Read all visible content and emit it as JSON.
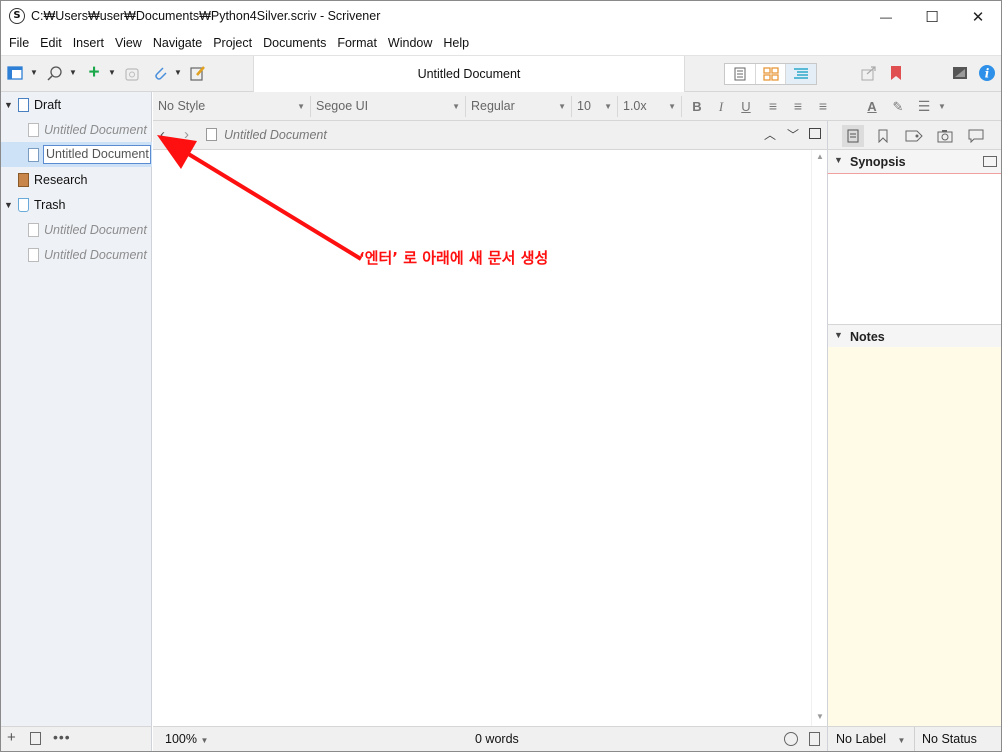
{
  "window": {
    "title": "C:₩Users₩user₩Documents₩Python4Silver.scriv - Scrivener",
    "logo": "S",
    "controls": {
      "minimize": "—",
      "maximize": "☐",
      "close": "✕"
    }
  },
  "menu": [
    "File",
    "Edit",
    "Insert",
    "View",
    "Navigate",
    "Project",
    "Documents",
    "Format",
    "Window",
    "Help"
  ],
  "toolbar": {
    "document_title": "Untitled Document",
    "icons": [
      "binder-toggle-icon",
      "search-icon",
      "add-icon",
      "trash-icon",
      "attach-icon",
      "compose-icon",
      "view-document-icon",
      "view-corkboard-icon",
      "view-outline-icon",
      "share-icon",
      "bookmark-icon",
      "composition-mode-icon",
      "info-icon"
    ],
    "accent_green": "#1aa84a",
    "accent_blue": "#2e7fd6",
    "bookmark_red": "#e05050",
    "corkboard_orange": "#e8983a"
  },
  "binder": {
    "items": [
      {
        "label": "Draft",
        "italic": false,
        "expanded": true
      },
      {
        "label": "Untitled Document",
        "italic": true
      },
      {
        "label": "Untitled Document",
        "editing": true
      },
      {
        "label": "Research",
        "italic": false
      },
      {
        "label": "Trash",
        "italic": false,
        "expanded": true
      },
      {
        "label": "Untitled Document",
        "italic": true
      },
      {
        "label": "Untitled Document",
        "italic": true
      }
    ],
    "selected_bg": "#cde2f7"
  },
  "formatbar": {
    "style": "No Style",
    "font": "Segoe UI",
    "weight": "Regular",
    "size": "10",
    "line_spacing": "1.0x"
  },
  "header": {
    "document_title": "Untitled Document"
  },
  "inspector": {
    "synopsis_label": "Synopsis",
    "notes_label": "Notes",
    "notes_bg": "#fffbe6"
  },
  "footer": {
    "zoom": "100%",
    "word_count": "0 words",
    "label": "No Label",
    "status": "No Status"
  },
  "annotation": {
    "text": "‘엔터’ 로 아래에 새 문서 생성",
    "color": "#ff1010"
  }
}
